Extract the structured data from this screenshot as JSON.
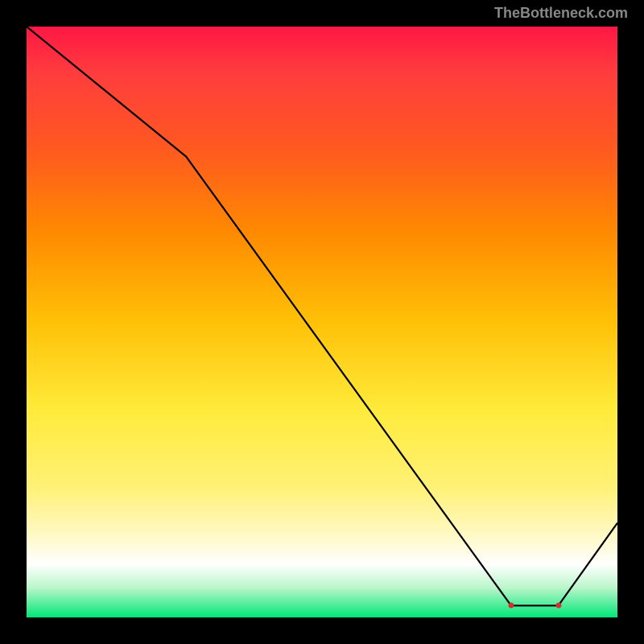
{
  "watermark": "TheBottleneck.com",
  "chart_data": {
    "type": "line",
    "title": "",
    "xlabel": "",
    "ylabel": "",
    "xlim": [
      0,
      100
    ],
    "ylim": [
      0,
      100
    ],
    "x": [
      0,
      27,
      82,
      90,
      100
    ],
    "values": [
      100,
      78,
      2,
      2,
      16
    ],
    "annotation_label": "",
    "annotation_x": 86,
    "annotation_y": 2,
    "dot_start_x": 82,
    "dot_start_y": 2,
    "dot_end_x": 90,
    "dot_end_y": 2,
    "background_gradient": [
      "#ff1744",
      "#ff5722",
      "#ffc107",
      "#ffeb3b",
      "#ffffff",
      "#00e676"
    ]
  }
}
